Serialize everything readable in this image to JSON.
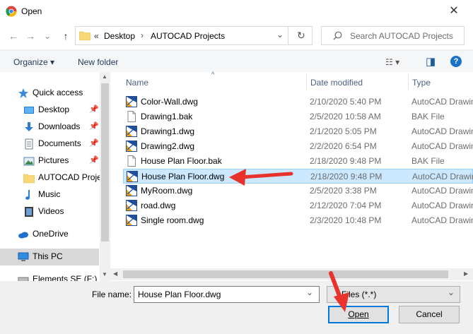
{
  "window": {
    "title": "Open",
    "close_glyph": "✕"
  },
  "address_bar": {
    "back_glyph": "←",
    "forward_glyph": "→",
    "recent_glyph": "⌄",
    "up_glyph": "↑",
    "crumb_overflow": "«",
    "crumbs": [
      "Desktop",
      "AUTOCAD Projects"
    ],
    "crumb_sep": "›",
    "dropdown_glyph": "⌄",
    "refresh_glyph": "↻",
    "search_placeholder": "Search AUTOCAD Projects"
  },
  "toolbar": {
    "organize": "Organize ▾",
    "new_folder": "New folder",
    "view_glyph": "☷ ▾",
    "pane_glyph": "◨",
    "help_glyph": "?"
  },
  "sidebar": {
    "items": [
      {
        "label": "Quick access",
        "icon": "star-icon"
      },
      {
        "label": "Desktop",
        "icon": "desktop-folder-icon",
        "pinned": true
      },
      {
        "label": "Downloads",
        "icon": "downloads-folder-icon",
        "pinned": true
      },
      {
        "label": "Documents",
        "icon": "documents-folder-icon",
        "pinned": true
      },
      {
        "label": "Pictures",
        "icon": "pictures-folder-icon",
        "pinned": true
      },
      {
        "label": "AUTOCAD Projec",
        "icon": "folder-icon"
      },
      {
        "label": "Music",
        "icon": "music-icon"
      },
      {
        "label": "Videos",
        "icon": "videos-icon"
      },
      {
        "label": "OneDrive",
        "icon": "onedrive-icon"
      },
      {
        "label": "This PC",
        "icon": "this-pc-icon",
        "selected": true
      },
      {
        "label": "Elements SE (F:)",
        "icon": "drive-icon"
      }
    ],
    "pin_glyph": "📌"
  },
  "file_list": {
    "columns": [
      "Name",
      "Date modified",
      "Type"
    ],
    "sort_glyph": "^",
    "rows": [
      {
        "name": "Color-Wall.dwg",
        "date": "2/10/2020 5:40 PM",
        "type": "AutoCAD Drawing",
        "kind": "dwg"
      },
      {
        "name": "Drawing1.bak",
        "date": "2/5/2020 10:58 AM",
        "type": "BAK File",
        "kind": "bak"
      },
      {
        "name": "Drawing1.dwg",
        "date": "2/1/2020 5:05 PM",
        "type": "AutoCAD Drawing",
        "kind": "dwg"
      },
      {
        "name": "Drawing2.dwg",
        "date": "2/2/2020 6:54 PM",
        "type": "AutoCAD Drawing",
        "kind": "dwg"
      },
      {
        "name": "House Plan Floor.bak",
        "date": "2/18/2020 9:48 PM",
        "type": "BAK File",
        "kind": "bak"
      },
      {
        "name": "House Plan Floor.dwg",
        "date": "2/18/2020 9:48 PM",
        "type": "AutoCAD Drawing",
        "kind": "dwg",
        "selected": true
      },
      {
        "name": "MyRoom.dwg",
        "date": "2/5/2020 3:38 PM",
        "type": "AutoCAD Drawing",
        "kind": "dwg"
      },
      {
        "name": "road.dwg",
        "date": "2/12/2020 7:04 PM",
        "type": "AutoCAD Drawing",
        "kind": "dwg"
      },
      {
        "name": "Single room.dwg",
        "date": "2/3/2020 10:48 PM",
        "type": "AutoCAD Drawing",
        "kind": "dwg"
      }
    ]
  },
  "bottom": {
    "file_name_label": "File name:",
    "file_name_value": "House Plan Floor.dwg",
    "file_type_value": "Files (*.*)",
    "open_label": "Open",
    "cancel_label": "Cancel",
    "dropdown_glyph": "⌄"
  },
  "colors": {
    "accent": "#0078d7",
    "selection": "#cce8ff",
    "annotation_arrow": "#e8322b"
  }
}
